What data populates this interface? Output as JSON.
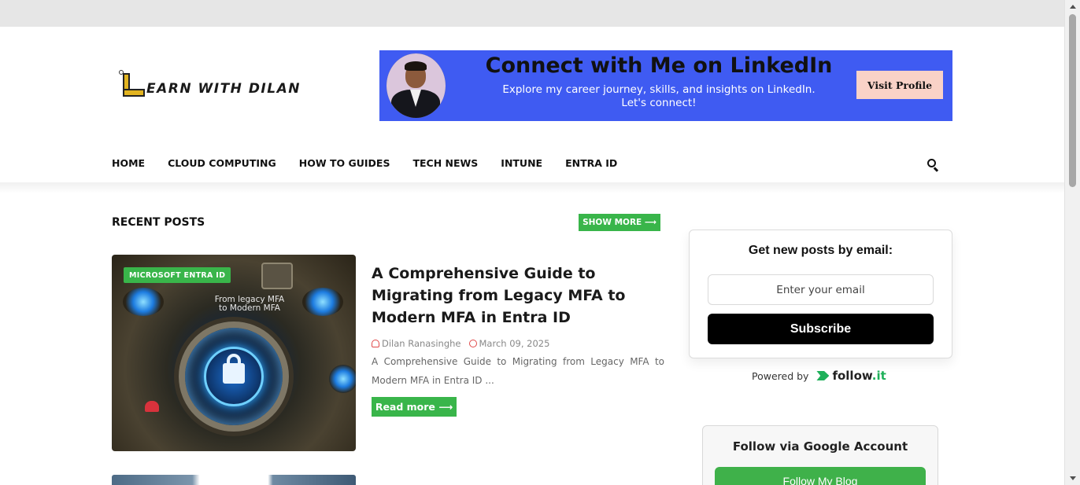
{
  "site": {
    "logo_text": "EARN WITH DILAN",
    "logo_initial": "L"
  },
  "banner": {
    "title": "Connect with Me on LinkedIn",
    "subtitle_line1": "Explore my career journey, skills, and insights on LinkedIn.",
    "subtitle_line2": "Let's connect!",
    "button_label": "Visit Profile",
    "background_color": "#3f5bf2",
    "button_color": "#f9d2c7"
  },
  "nav": {
    "items": [
      {
        "label": "HOME"
      },
      {
        "label": "CLOUD COMPUTING"
      },
      {
        "label": "HOW TO GUIDES"
      },
      {
        "label": "TECH NEWS"
      },
      {
        "label": "INTUNE"
      },
      {
        "label": "ENTRA ID"
      }
    ],
    "search_icon": "search-icon"
  },
  "recent": {
    "title": "RECENT POSTS",
    "show_more_label": "SHOW MORE ⟶",
    "accent_color": "#39b54a"
  },
  "post": {
    "tag": "MICROSOFT ENTRA ID",
    "image_text_line1": "From legacy MFA",
    "image_text_line2": "to Modern MFA",
    "title": "A Comprehensive Guide to Migrating from Legacy MFA to Modern MFA in Entra ID",
    "author": "Dilan Ranasinghe",
    "date": "March 09, 2025",
    "excerpt": "A Comprehensive Guide to Migrating from Legacy MFA to Modern MFA in Entra ID ...",
    "read_more_label": "Read more ⟶"
  },
  "sidebar": {
    "email": {
      "heading": "Get new posts by email:",
      "input_placeholder": "Enter your email",
      "button_label": "Subscribe",
      "powered_by": "Powered by",
      "brand_name": "follow",
      "brand_suffix": ".it"
    },
    "google": {
      "heading": "Follow via Google Account",
      "button_label": "Follow My Blog"
    }
  }
}
